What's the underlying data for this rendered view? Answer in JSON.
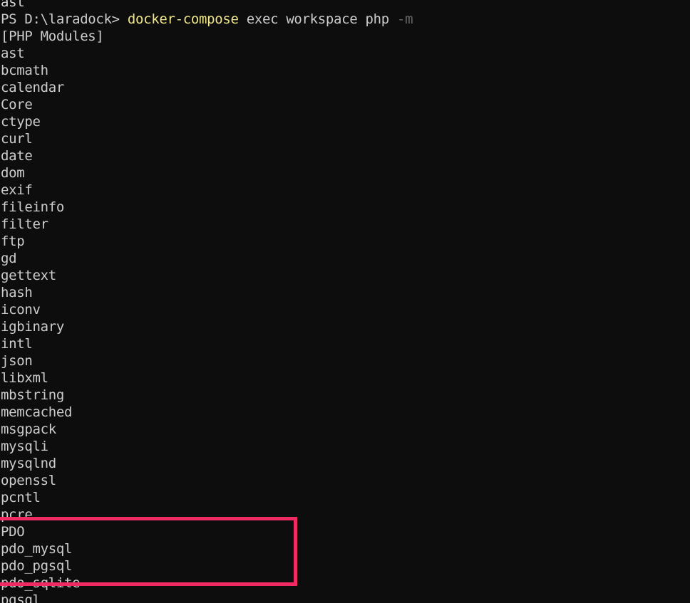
{
  "terminal": {
    "background_color": "#0d0d0d",
    "foreground_color": "#cccccc",
    "command_color": "#f0e68c",
    "dim_color": "#666666",
    "highlight_color": "#f02a62",
    "partial_top_line": "ast",
    "prompt": {
      "prefix": "PS D:\\laradock>",
      "command": "docker-compose",
      "args": "exec workspace php",
      "flag": "-m"
    },
    "output_header": "[PHP Modules]",
    "modules": [
      "ast",
      "bcmath",
      "calendar",
      "Core",
      "ctype",
      "curl",
      "date",
      "dom",
      "exif",
      "fileinfo",
      "filter",
      "ftp",
      "gd",
      "gettext",
      "hash",
      "iconv",
      "igbinary",
      "intl",
      "json",
      "libxml",
      "mbstring",
      "memcached",
      "msgpack",
      "mysqli",
      "mysqlnd",
      "openssl",
      "pcntl",
      "pcre",
      "PDO",
      "pdo_mysql",
      "pdo_pgsql",
      "pdo_sqlite",
      "pgsql"
    ],
    "highlighted_modules": [
      "PDO",
      "pdo_mysql",
      "pdo_pgsql",
      "pdo_sqlite"
    ]
  }
}
